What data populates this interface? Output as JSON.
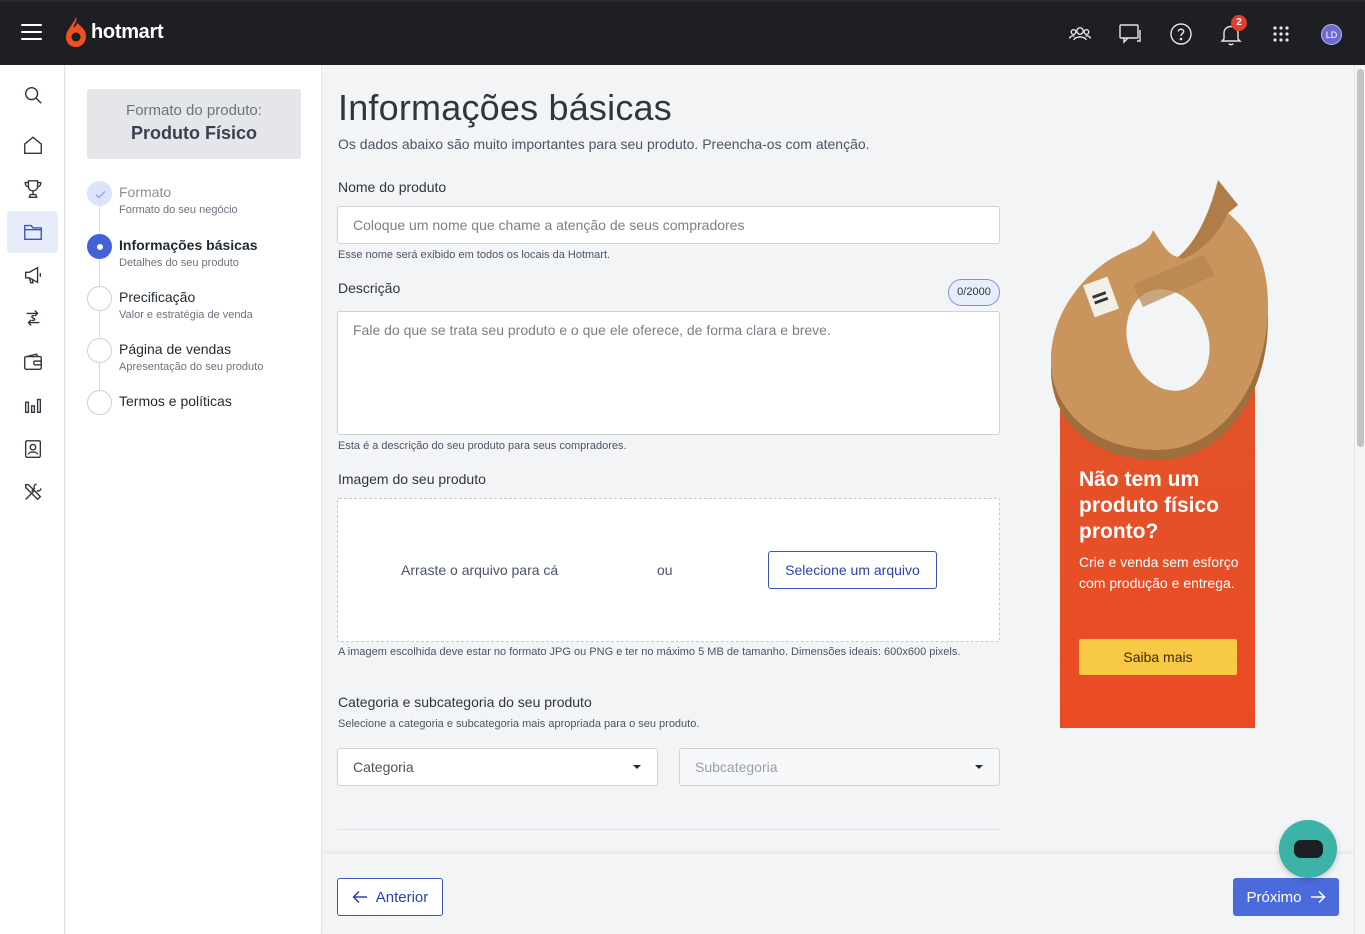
{
  "header": {
    "brand": "hotmart",
    "notification_count": "2",
    "avatar_initials": "LD",
    "icons": [
      "menu-icon",
      "community-icon",
      "messages-icon",
      "help-icon",
      "bell-icon",
      "apps-grid-icon"
    ]
  },
  "rail": {
    "items": [
      "search-icon",
      "home-icon",
      "trophy-icon",
      "products-folder-icon",
      "megaphone-icon",
      "transactions-icon",
      "wallet-icon",
      "analytics-icon",
      "contacts-icon",
      "tools-icon"
    ],
    "active": "products-folder-icon"
  },
  "steps_panel": {
    "format_label": "Formato do produto:",
    "format_value": "Produto Físico",
    "steps": [
      {
        "title": "Formato",
        "subtitle": "Formato do seu negócio",
        "state": "done"
      },
      {
        "title": "Informações básicas",
        "subtitle": "Detalhes do seu produto",
        "state": "active"
      },
      {
        "title": "Precificação",
        "subtitle": "Valor e estratégia de venda",
        "state": "pending"
      },
      {
        "title": "Página de vendas",
        "subtitle": "Apresentação do seu produto",
        "state": "pending"
      },
      {
        "title": "Termos e políticas",
        "subtitle": "",
        "state": "pending"
      }
    ]
  },
  "form": {
    "title": "Informações básicas",
    "subtitle": "Os dados abaixo são muito importantes para seu produto. Preencha-os com atenção.",
    "name": {
      "label": "Nome do produto",
      "placeholder": "Coloque um nome que chame a atenção de seus compradores",
      "value": "",
      "help": "Esse nome será exibido em todos os locais da Hotmart."
    },
    "description": {
      "label": "Descrição",
      "counter": "0/2000",
      "placeholder": "Fale do que se trata seu produto e o que ele oferece, de forma clara e breve.",
      "value": "",
      "help": "Esta é a descrição do seu produto para seus compradores."
    },
    "image": {
      "label": "Imagem do seu produto",
      "drag_text": "Arraste o arquivo para cá",
      "or_text": "ou",
      "select_button": "Selecione um arquivo",
      "help": "A imagem escolhida deve estar no formato JPG ou PNG e ter no máximo 5 MB de tamanho. Dimensões ideais: 600x600 pixels."
    },
    "category": {
      "label": "Categoria e subcategoria do seu produto",
      "help": "Selecione a categoria e subcategoria mais apropriada para o seu produto.",
      "category_placeholder": "Categoria",
      "subcategory_placeholder": "Subcategoria"
    }
  },
  "promo": {
    "title": "Não tem um produto físico pronto?",
    "text": "Crie e venda sem esforço com produção e entrega.",
    "button": "Saiba mais",
    "color": "#e84e25"
  },
  "footer": {
    "prev_label": "Anterior",
    "next_label": "Próximo"
  },
  "colors": {
    "topbar": "#1e1f22",
    "accent": "#4b6bdd",
    "brand_flame": "#f04e23",
    "chat": "#3cb3a6"
  }
}
